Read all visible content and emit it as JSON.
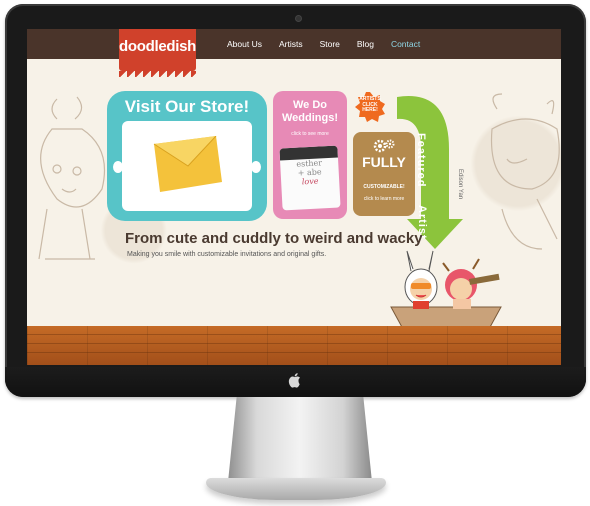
{
  "site": {
    "logo": "doodledish",
    "nav": [
      "About Us",
      "Artists",
      "Store",
      "Blog",
      "Contact"
    ],
    "nav_active_index": 4
  },
  "store_panel": {
    "title": "Visit Our Store!"
  },
  "wedding_panel": {
    "title_line1": "We Do",
    "title_line2": "Weddings!",
    "cta": "click to see more",
    "card_lines": [
      "esther",
      "+  abe",
      "love"
    ]
  },
  "badge": {
    "lines": [
      "ARTISTS",
      "CLICK",
      "HERE!"
    ]
  },
  "custom_panel": {
    "title_line1": "FULLY",
    "subtitle": "CUSTOMIZABLE!",
    "cta": "click to learn more"
  },
  "featured": {
    "label": "Featured",
    "label2": "Artist",
    "artist_name": "Edison Yan"
  },
  "tagline": "From cute and cuddly to weird and wacky",
  "subtagline": "Making you smile with customizable invitations and original gifts.",
  "colors": {
    "header": "#4a342a",
    "logo": "#d0412b",
    "store": "#57c4c8",
    "wedding": "#e78ab6",
    "custom": "#b48a4e",
    "featured": "#8cc43c",
    "badge": "#ef6a1f",
    "floor": "#b65c20"
  }
}
